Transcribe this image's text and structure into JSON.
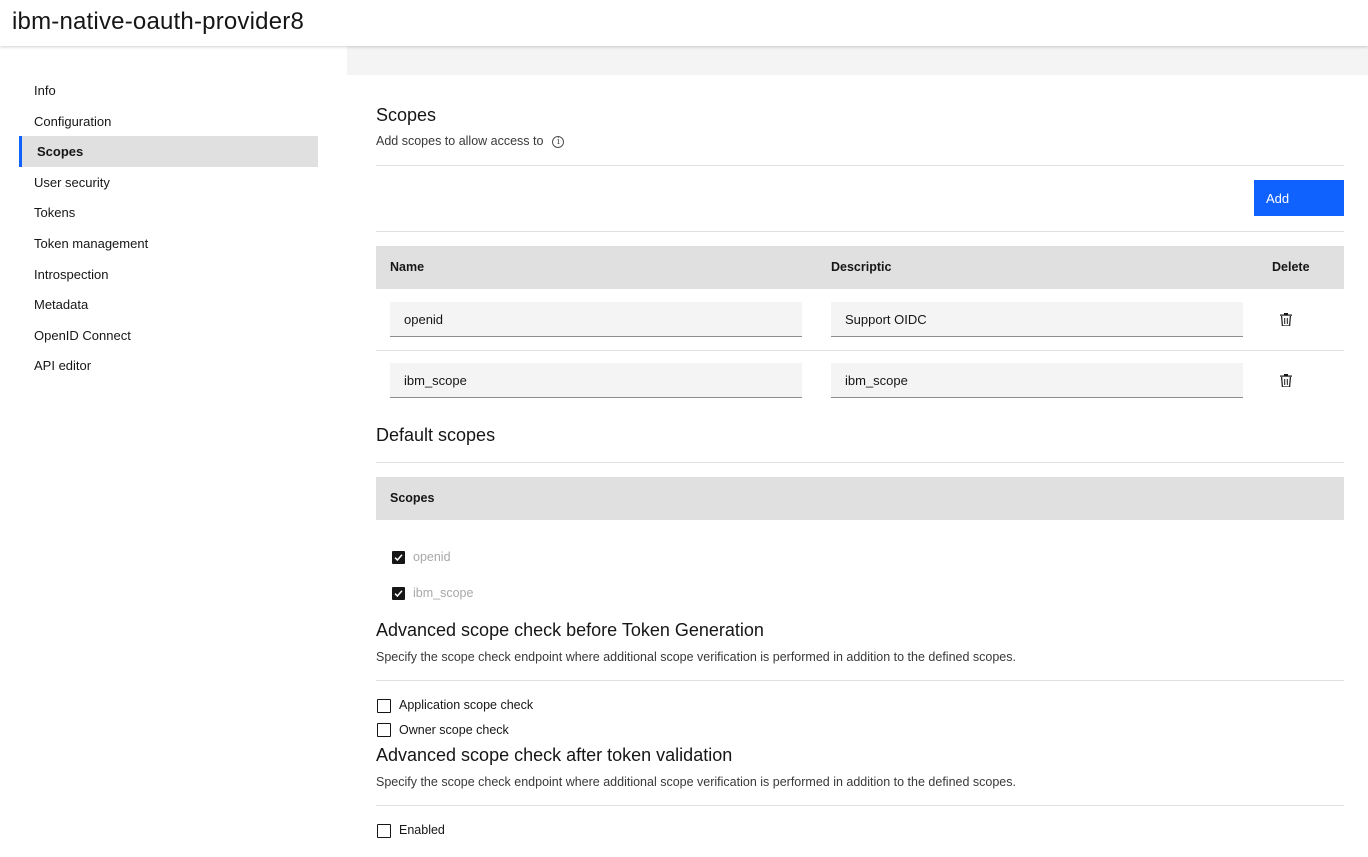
{
  "header": {
    "title": "ibm-native-oauth-provider8"
  },
  "sidebar": {
    "items": [
      {
        "label": "Info"
      },
      {
        "label": "Configuration"
      },
      {
        "label": "Scopes",
        "active": true
      },
      {
        "label": "User security"
      },
      {
        "label": "Tokens"
      },
      {
        "label": "Token management"
      },
      {
        "label": "Introspection"
      },
      {
        "label": "Metadata"
      },
      {
        "label": "OpenID Connect"
      },
      {
        "label": "API editor"
      }
    ]
  },
  "scopes": {
    "title": "Scopes",
    "subtitle": "Add scopes to allow access to",
    "info_icon": "info-icon",
    "add_label": "Add",
    "table": {
      "headers": {
        "name": "Name",
        "description": "Descriptic",
        "delete": "Delete"
      },
      "rows": [
        {
          "name": "openid",
          "description": "Support OIDC"
        },
        {
          "name": "ibm_scope",
          "description": "ibm_scope"
        }
      ]
    }
  },
  "default_scopes": {
    "title": "Default scopes",
    "header": "Scopes",
    "items": [
      {
        "label": "openid",
        "checked": true
      },
      {
        "label": "ibm_scope",
        "checked": true
      }
    ]
  },
  "advanced_before": {
    "title": "Advanced scope check before Token Generation",
    "helper": "Specify the scope check endpoint where additional scope verification is performed in addition to the defined scopes.",
    "options": [
      {
        "label": "Application scope check",
        "checked": false
      },
      {
        "label": "Owner scope check",
        "checked": false
      }
    ]
  },
  "advanced_after": {
    "title": "Advanced scope check after token validation",
    "helper": "Specify the scope check endpoint where additional scope verification is performed in addition to the defined scopes.",
    "options": [
      {
        "label": "Enabled",
        "checked": false
      }
    ]
  },
  "colors": {
    "primary": "#0f62fe",
    "active_nav_bg": "#e0e0e0",
    "field_bg": "#f4f4f4"
  }
}
